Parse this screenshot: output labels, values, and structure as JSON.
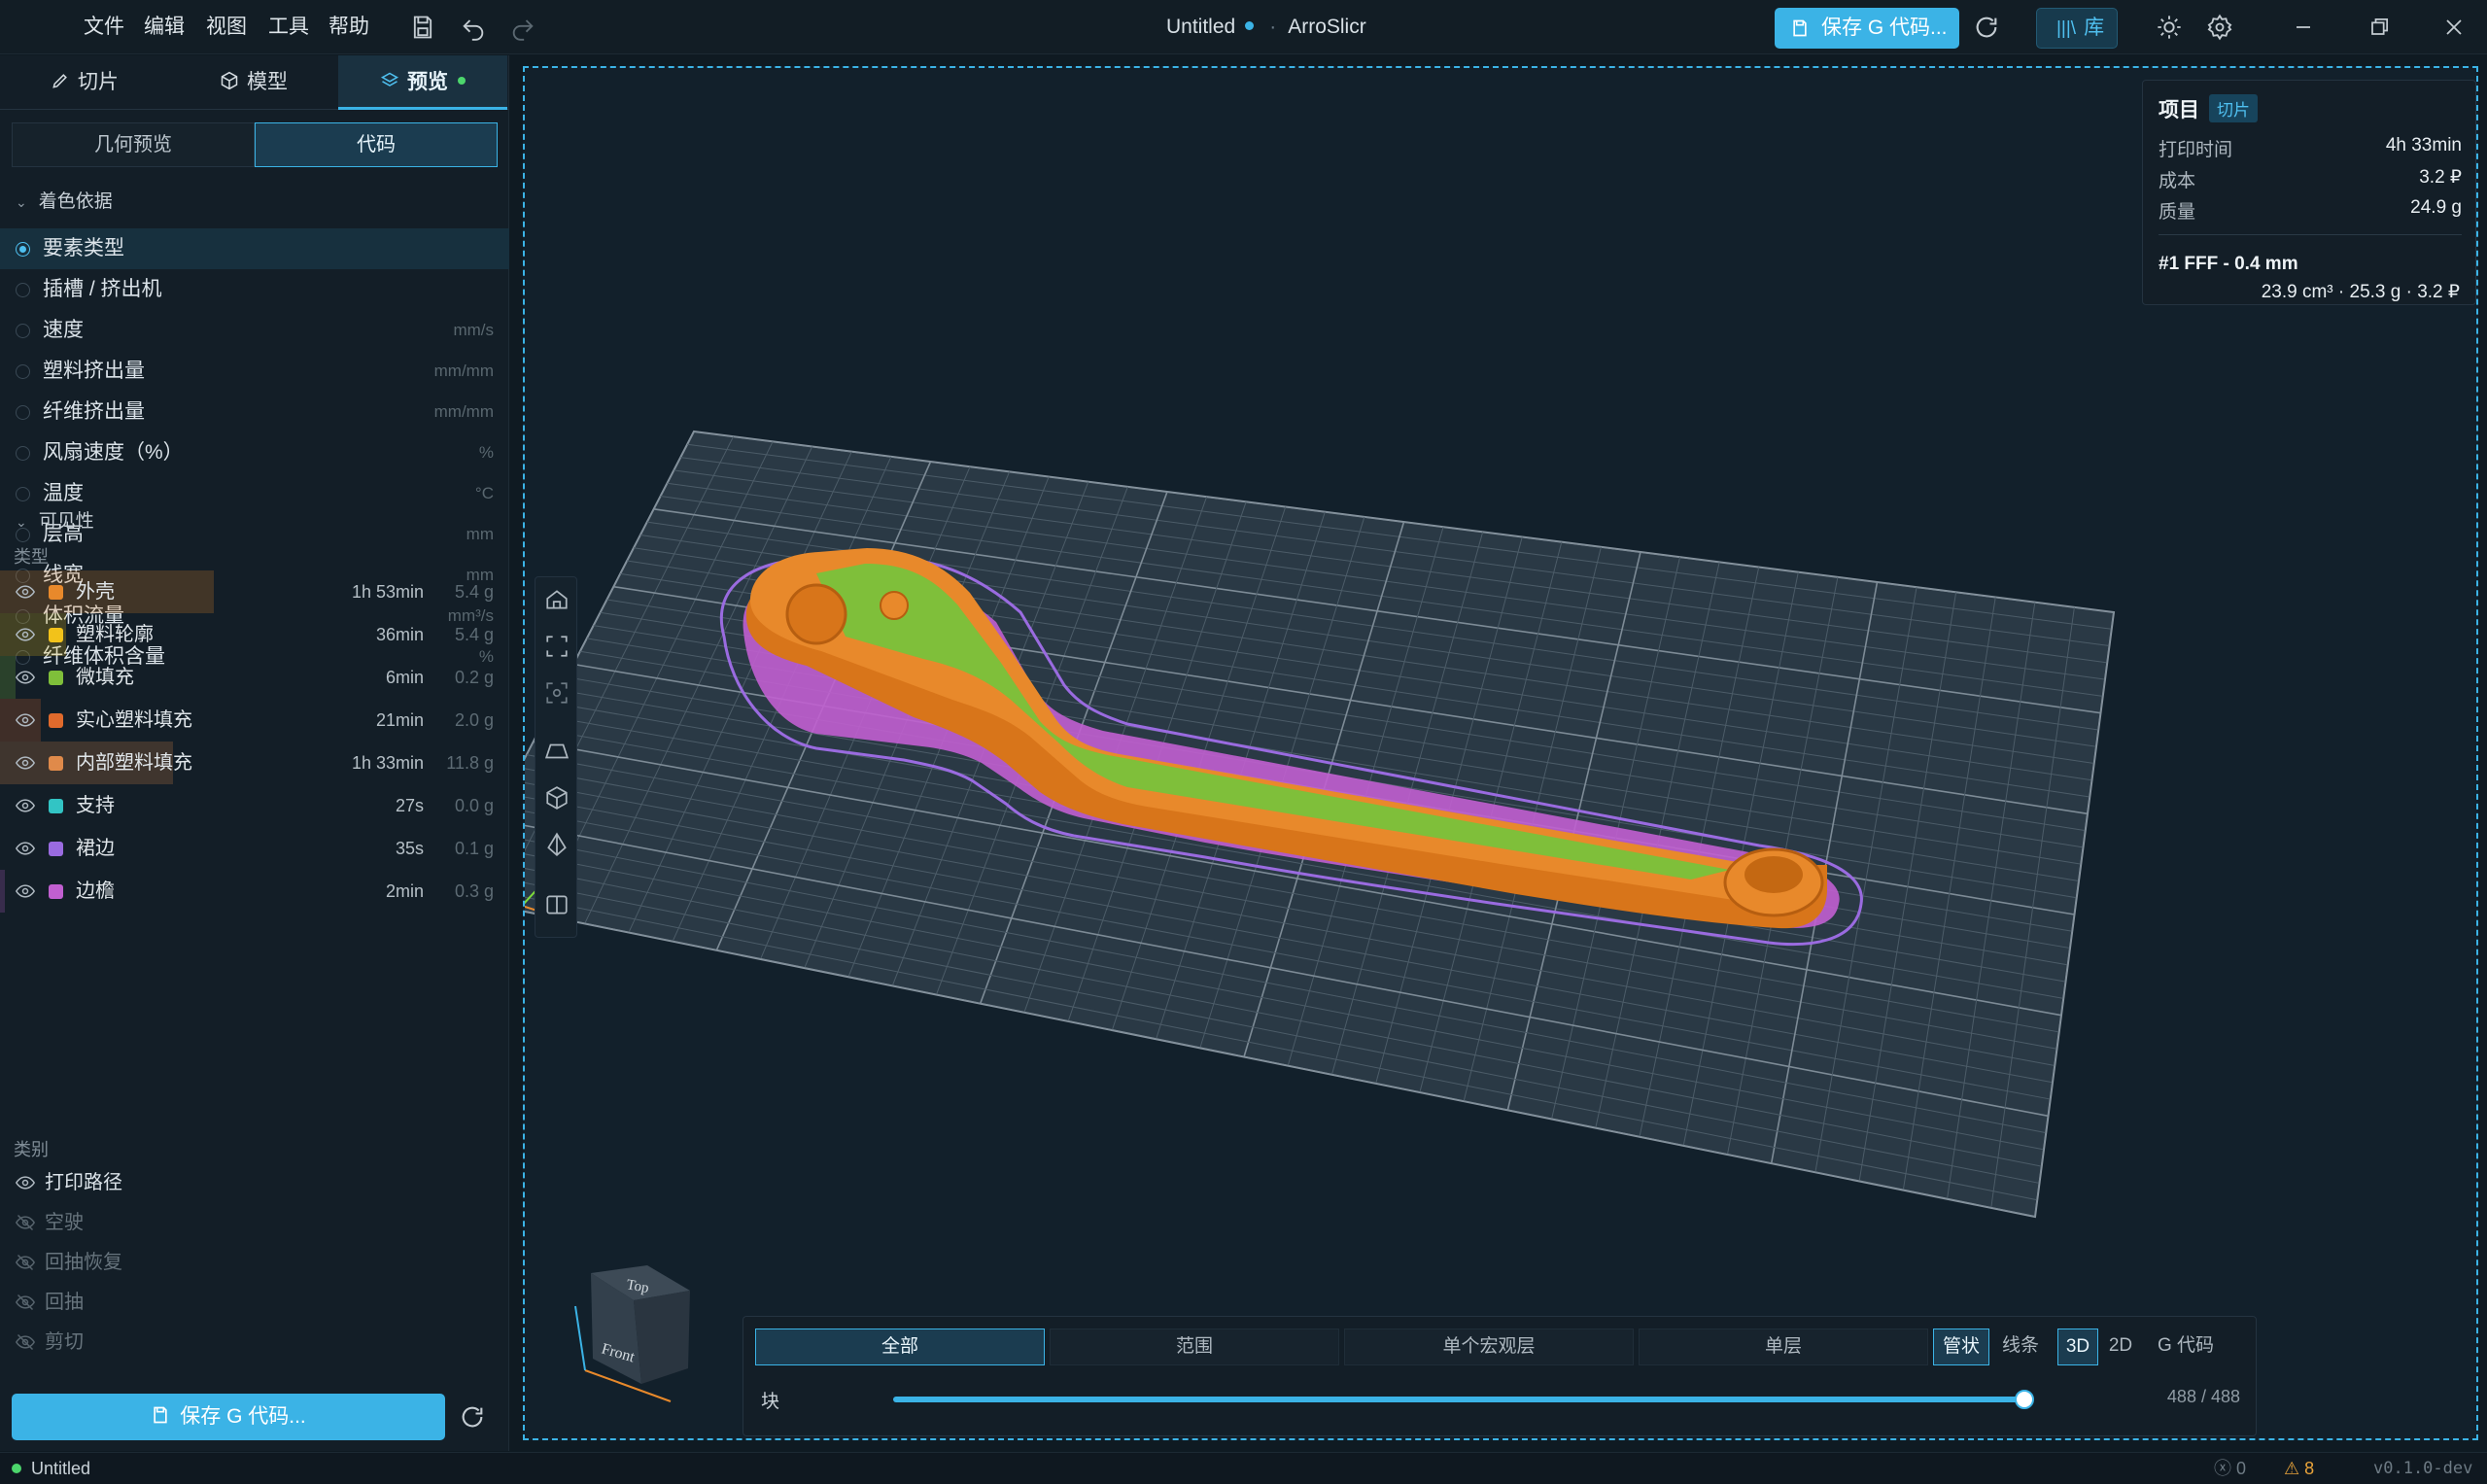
{
  "menu": [
    "文件",
    "编辑",
    "视图",
    "工具",
    "帮助"
  ],
  "title": {
    "file": "Untitled",
    "app": "ArroSlicr"
  },
  "toolbar": {
    "save_gcode": "保存 G 代码...",
    "library": "库"
  },
  "tabs": [
    {
      "label": "切片",
      "icon": "pencil-icon"
    },
    {
      "label": "模型",
      "icon": "cube-icon"
    },
    {
      "label": "预览",
      "icon": "layers-icon"
    }
  ],
  "preview_modes": {
    "geometry": "几何预览",
    "code": "代码",
    "selected": "代码"
  },
  "color_by": {
    "heading": "着色依据",
    "selected": "要素类型",
    "options": [
      {
        "label": "要素类型",
        "unit": ""
      },
      {
        "label": "插槽 / 挤出机",
        "unit": ""
      },
      {
        "label": "速度",
        "unit": "mm/s"
      },
      {
        "label": "塑料挤出量",
        "unit": "mm/mm"
      },
      {
        "label": "纤维挤出量",
        "unit": "mm/mm"
      },
      {
        "label": "风扇速度（%）",
        "unit": "%"
      },
      {
        "label": "温度",
        "unit": "°C"
      },
      {
        "label": "层高",
        "unit": "mm"
      },
      {
        "label": "线宽",
        "unit": "mm"
      },
      {
        "label": "体积流量",
        "unit": "mm³/s"
      },
      {
        "label": "纤维体积含量",
        "unit": "%"
      }
    ]
  },
  "visibility": {
    "heading": "可见性",
    "types_label": "类型",
    "types": [
      {
        "label": "外壳",
        "time": "1h 53min",
        "mass": "5.4 g",
        "color": "#e8892b",
        "share": 0.42
      },
      {
        "label": "塑料轮廓",
        "time": "36min",
        "mass": "5.4 g",
        "color": "#f2c21a",
        "share": 0.13
      },
      {
        "label": "微填充",
        "time": "6min",
        "mass": "0.2 g",
        "color": "#7fbf3a",
        "share": 0.03
      },
      {
        "label": "实心塑料填充",
        "time": "21min",
        "mass": "2.0 g",
        "color": "#e06a2c",
        "share": 0.08
      },
      {
        "label": "内部塑料填充",
        "time": "1h 33min",
        "mass": "11.8 g",
        "color": "#e08a4a",
        "share": 0.34
      },
      {
        "label": "支持",
        "time": "27s",
        "mass": "0.0 g",
        "color": "#32c4c4",
        "share": 0.0
      },
      {
        "label": "裙边",
        "time": "35s",
        "mass": "0.1 g",
        "color": "#9a6be0",
        "share": 0.0
      },
      {
        "label": "边檐",
        "time": "2min",
        "mass": "0.3 g",
        "color": "#c15fd0",
        "share": 0.01
      }
    ],
    "categories_label": "类别",
    "categories": [
      {
        "label": "打印路径",
        "on": true
      },
      {
        "label": "空驶",
        "on": false
      },
      {
        "label": "回抽恢复",
        "on": false
      },
      {
        "label": "回抽",
        "on": false
      },
      {
        "label": "剪切",
        "on": false
      }
    ]
  },
  "bottom_save": "保存 G 代码...",
  "info": {
    "title": "项目",
    "badge": "切片",
    "rows": [
      {
        "k": "打印时间",
        "v": "4h 33min"
      },
      {
        "k": "成本",
        "v": "3.2 ₽"
      },
      {
        "k": "质量",
        "v": "24.9 g"
      }
    ],
    "extruder": "#1 FFF - 0.4 mm",
    "extruder_detail": "23.9 cm³ · 25.3 g · 3.2 ₽"
  },
  "view_cube": {
    "top": "Top",
    "front": "Front"
  },
  "layer_modes": [
    "全部",
    "范围",
    "单个宏观层",
    "单层"
  ],
  "layer_mode_selected": "全部",
  "render_modes": [
    "管状",
    "线条"
  ],
  "render_mode_selected": "管状",
  "dim_modes": [
    "3D",
    "2D"
  ],
  "dim_mode_selected": "3D",
  "gcode_button": "G 代码",
  "slider": {
    "label": "块",
    "value": 488,
    "max": 488,
    "text": "488 / 488"
  },
  "status": {
    "file": "Untitled",
    "errors": "0",
    "warnings": "8",
    "version": "v0.1.0-dev"
  },
  "colors": {
    "accent": "#3bb3e6",
    "shell": "#e8892b",
    "top_infill": "#7fbf3a",
    "skirt": "#9a6be0",
    "brim": "#c15fd0"
  }
}
